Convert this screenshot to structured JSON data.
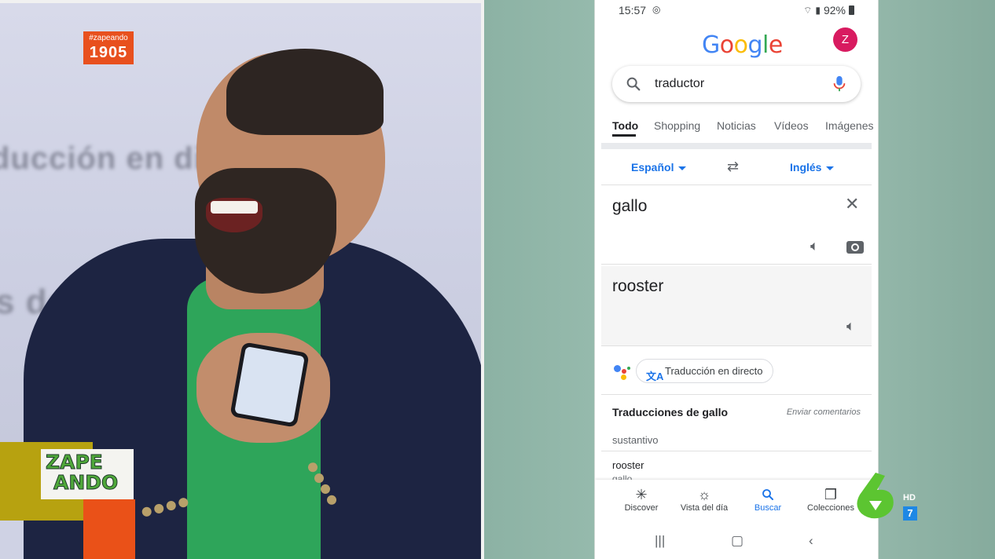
{
  "overlay": {
    "hashtag": "#zapeando",
    "counter": "1905",
    "show_logo_line1": "ZAPE",
    "show_logo_line2": "ANDO",
    "channel_hd": "HD",
    "channel_sub": "7"
  },
  "background_text": {
    "line1": "ducción en dir",
    "line2": "s de a"
  },
  "phone": {
    "status": {
      "time": "15:57",
      "battery": "92%"
    },
    "logo_letters": [
      "G",
      "o",
      "o",
      "g",
      "l",
      "e"
    ],
    "avatar_letter": "Z",
    "search": {
      "query": "traductor"
    },
    "tabs": [
      {
        "label": "Todo",
        "active": true
      },
      {
        "label": "Shopping"
      },
      {
        "label": "Noticias"
      },
      {
        "label": "Vídeos"
      },
      {
        "label": "Imágenes"
      }
    ],
    "translator": {
      "source_lang": "Español",
      "target_lang": "Inglés",
      "source_text": "gallo",
      "target_text": "rooster",
      "live_chip": "Traducción en directo"
    },
    "translations": {
      "title": "Traducciones de gallo",
      "feedback": "Enviar comentarios",
      "pos": "sustantivo",
      "term": "rooster",
      "back": "gallo"
    },
    "bottom_nav": [
      {
        "label": "Discover",
        "icon": "asterisk-icon"
      },
      {
        "label": "Vista del día",
        "icon": "sunrise-icon"
      },
      {
        "label": "Buscar",
        "icon": "search-icon",
        "active": true
      },
      {
        "label": "Colecciones",
        "icon": "collections-icon"
      }
    ]
  },
  "colors": {
    "accent_blue": "#1a73e8",
    "zapeando_orange": "#e8501e",
    "zapeando_olive": "#b7a210",
    "channel_green": "#5cc531",
    "avatar_pink": "#d81b60"
  }
}
